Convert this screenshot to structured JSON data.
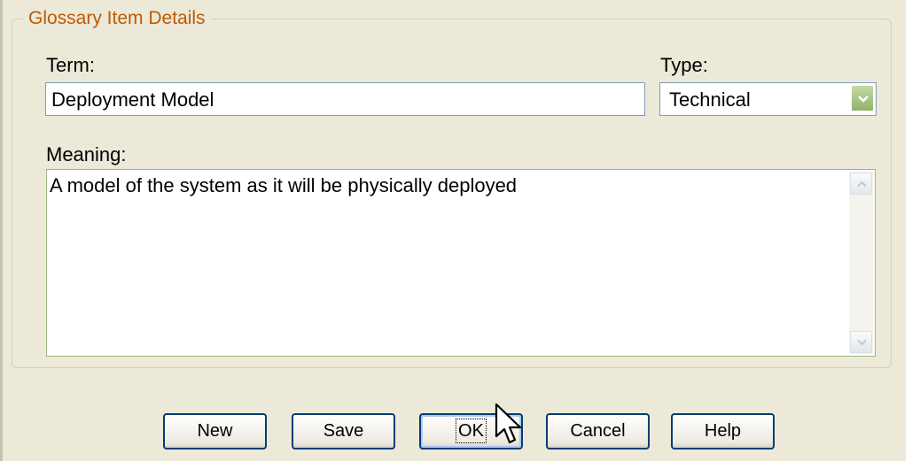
{
  "group": {
    "title": "Glossary Item Details"
  },
  "term": {
    "label": "Term:",
    "value": "Deployment Model"
  },
  "type": {
    "label": "Type:",
    "selected": "Technical"
  },
  "meaning": {
    "label": "Meaning:",
    "value": "A model of the system as it will be physically deployed"
  },
  "buttons": {
    "new": "New",
    "save": "Save",
    "ok": "OK",
    "cancel": "Cancel",
    "help": "Help"
  },
  "icons": {
    "combo_arrow": "chevron-down-icon",
    "scroll_up": "scroll-up-arrow-icon",
    "scroll_down": "scroll-down-arrow-icon",
    "cursor": "mouse-pointer-icon"
  },
  "colors": {
    "dialog_bg": "#ece9d8",
    "group_title": "#c05a00",
    "field_border": "#7f9db9",
    "button_border": "#003c74",
    "combo_button": "#9ebd77"
  }
}
